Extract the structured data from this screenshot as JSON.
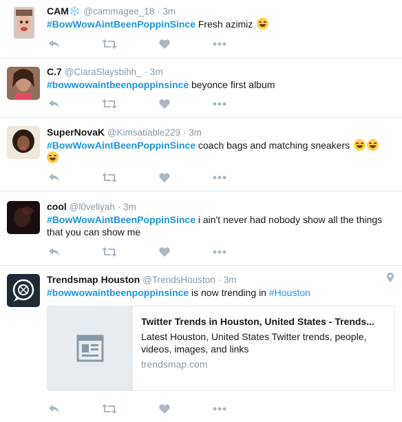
{
  "tweets": [
    {
      "name": "CAM❄️",
      "handle": "@cammagee_18",
      "time": "· 3m",
      "hashtag": "#BowWowAintBeenPoppinSince",
      "text": " Fresh azimiz",
      "emoji_count": 1
    },
    {
      "name": "C.7",
      "handle": "@CiaraSlaysbihh_",
      "time": "· 3m",
      "hashtag": "#bowwowaintbeenpoppinsince",
      "text": " beyonce first album"
    },
    {
      "name": "SuperNovaK",
      "handle": "@Kimsatiable229",
      "time": "· 3m",
      "hashtag": "#BowWowAintBeenPoppinSince",
      "text": " coach bags and matching sneakers",
      "emoji_count": 3
    },
    {
      "name": "cool",
      "handle": "@l0veliyah",
      "time": "· 3m",
      "hashtag": "#BowWowAintBeenPoppinSince",
      "text": " i ain't never had nobody show all the things that you can show me"
    },
    {
      "name": "Trendsmap Houston",
      "handle": "@TrendsHouston",
      "time": "· 3m",
      "hashtag": "#bowwowaintbeenpoppinsince",
      "text": " is now trending in ",
      "location_tag": "#Houston",
      "card": {
        "title": "Twitter Trends in Houston, United States - Trends...",
        "description": "Latest Houston, United States Twitter trends, people, videos, images, and links",
        "url": "trendsmap.com"
      }
    }
  ],
  "icons": {
    "reply": "reply-icon",
    "retweet": "retweet-icon",
    "like": "heart-icon",
    "more": "more-icon",
    "geo": "location-pin-icon"
  },
  "colors": {
    "hashtag": "#1b95e0",
    "meta": "#8899a6",
    "action_icon": "#aab8c2",
    "divider": "#e1e8ed"
  }
}
